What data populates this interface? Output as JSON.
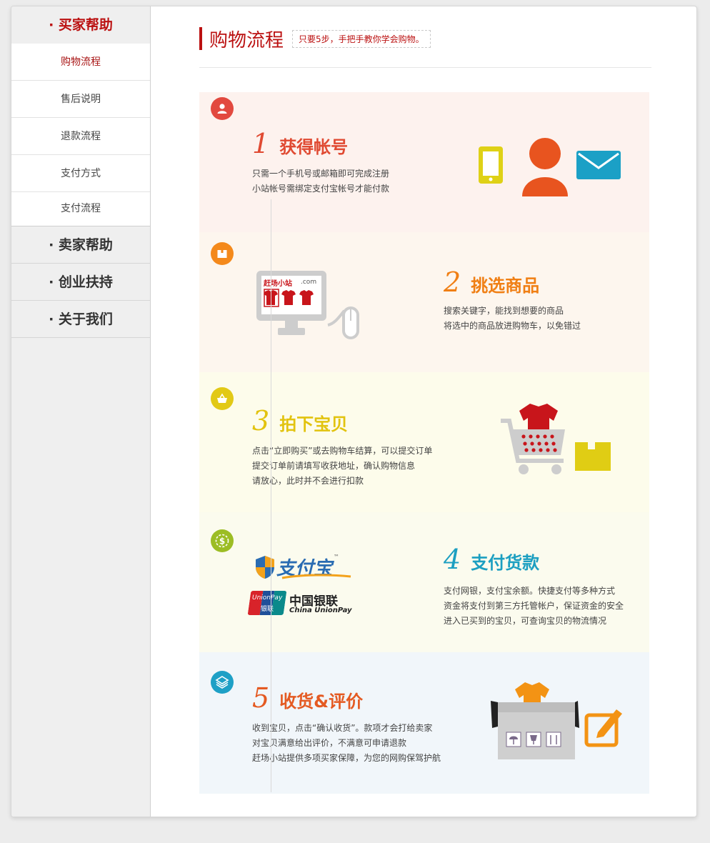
{
  "sidebar": {
    "sections": [
      {
        "label": "· 买家帮助",
        "active": true,
        "items": [
          "购物流程",
          "售后说明",
          "退款流程",
          "支付方式",
          "支付流程"
        ]
      },
      {
        "label": "· 卖家帮助"
      },
      {
        "label": "· 创业扶持"
      },
      {
        "label": "· 关于我们"
      }
    ]
  },
  "header": {
    "title": "购物流程",
    "tagline": "只要5步，手把手教你学会购物。"
  },
  "steps": [
    {
      "number": "1",
      "title": "获得帐号",
      "lines": [
        "只需一个手机号或邮箱即可完成注册",
        "小站帐号需绑定支付宝帐号才能付款"
      ],
      "icon": "user-icon",
      "accent": "#e04a32"
    },
    {
      "number": "2",
      "title": "挑选商品",
      "lines": [
        "搜索关键字，能找到想要的商品",
        "将选中的商品放进购物车，以免错过"
      ],
      "icon": "box-icon",
      "accent": "#f07f14",
      "monitor_logo": "赶场小站",
      "monitor_domain": ".com"
    },
    {
      "number": "3",
      "title": "拍下宝贝",
      "lines": [
        "点击“立即购买”或去购物车结算，可以提交订单",
        "提交订单前请填写收获地址，确认购物信息",
        "请放心，此时并不会进行扣款"
      ],
      "icon": "basket-icon",
      "accent": "#e2c30f"
    },
    {
      "number": "4",
      "title": "支付货款",
      "lines": [
        "支付网银，支付宝余额。快捷支付等多种方式",
        "资金将支付到第三方托管帐户，保证资金的安全",
        "进入已买到的宝贝，可查询宝贝的物流情况"
      ],
      "icon": "dollar-icon",
      "accent": "#1c9fc1",
      "alipay": "支付宝",
      "alipay_tm": "™",
      "unionpay_cn": "中国银联",
      "unionpay_en": "China UnionPay",
      "unionpay_card_en": "UnionPay",
      "unionpay_card_cn": "银联"
    },
    {
      "number": "5",
      "title": "收货&评价",
      "lines": [
        "收到宝贝，点击“确认收货”。款项才会打给卖家",
        "对宝贝满意给出评价，不满意可申请退款",
        "赶场小站提供多项买家保障，为您的网购保驾护航"
      ],
      "icon": "layers-icon",
      "accent": "#e45a22"
    }
  ]
}
